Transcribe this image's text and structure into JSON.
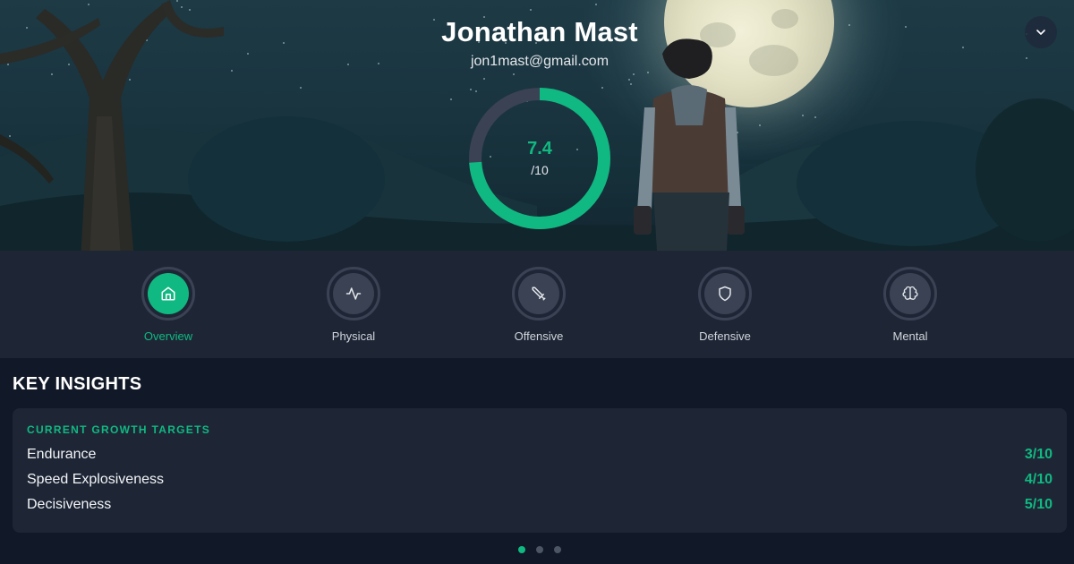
{
  "profile": {
    "name": "Jonathan Mast",
    "email": "jon1mast@gmail.com",
    "score": 7.4,
    "score_label": "7.4",
    "score_max": "/10",
    "score_max_value": 10
  },
  "colors": {
    "accent": "#10b981",
    "ring_track": "#3a4254",
    "background": "#111827",
    "panel": "#1e2636"
  },
  "tabs": [
    {
      "label": "Overview",
      "icon": "home-icon",
      "active": true
    },
    {
      "label": "Physical",
      "icon": "activity-icon",
      "active": false
    },
    {
      "label": "Offensive",
      "icon": "sword-icon",
      "active": false
    },
    {
      "label": "Defensive",
      "icon": "shield-icon",
      "active": false
    },
    {
      "label": "Mental",
      "icon": "brain-icon",
      "active": false
    }
  ],
  "insights": {
    "title": "KEY INSIGHTS",
    "card_heading": "CURRENT GROWTH TARGETS",
    "targets": [
      {
        "name": "Endurance",
        "score": "3/10"
      },
      {
        "name": "Speed Explosiveness",
        "score": "4/10"
      },
      {
        "name": "Decisiveness",
        "score": "5/10"
      }
    ]
  },
  "pagination": {
    "pages": 3,
    "active_page": 1
  },
  "header": {
    "collapse_icon": "chevron-down-icon"
  }
}
